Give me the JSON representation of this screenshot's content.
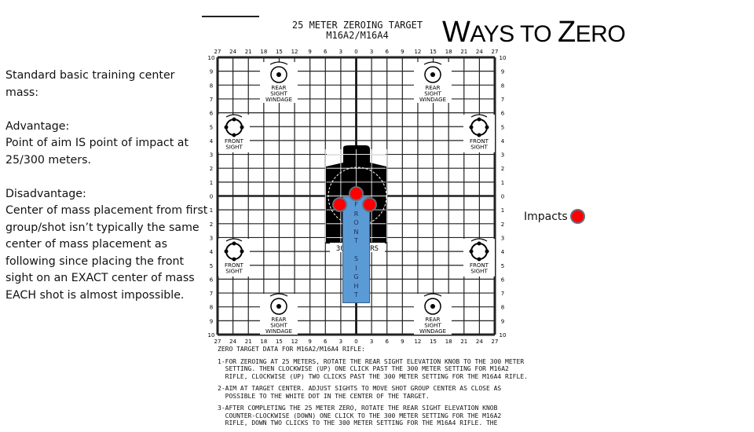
{
  "slide": {
    "title_first": "W",
    "title_rest": "AYS TO ",
    "title_z": "Z",
    "title_end": "ERO"
  },
  "left_text": {
    "heading": "Standard basic training center mass:",
    "advantage_label": "Advantage:",
    "advantage_text": "Point of aim IS point of impact at 25/300 meters.",
    "disadvantage_label": "Disadvantage:",
    "disadvantage_text": "Center of mass placement from first group/shot isn’t typically the same center of mass placement as following since placing the front sight on an EXACT center of mass EACH shot is almost impossible."
  },
  "target": {
    "title_line1": "25 METER ZEROING TARGET",
    "title_line2": "M16A2/M16A4",
    "col_labels": [
      "27",
      "24",
      "21",
      "18",
      "15",
      "12",
      "9",
      "6",
      "3",
      "0",
      "3",
      "6",
      "9",
      "12",
      "15",
      "18",
      "21",
      "24",
      "27"
    ],
    "row_labels": [
      "10",
      "9",
      "8",
      "7",
      "6",
      "5",
      "4",
      "3",
      "2",
      "1",
      "0",
      "1",
      "2",
      "3",
      "4",
      "5",
      "6",
      "7",
      "8",
      "9",
      "10"
    ],
    "rear_sight_label": [
      "REAR",
      "SIGHT",
      "WINDAGE"
    ],
    "front_sight_label": [
      "FRONT",
      "SIGHT"
    ],
    "silhouette_label": "300 METERS",
    "instructions_heading": "ZERO TARGET DATA FOR M16A2/M16A4 RIFLE:",
    "instructions": [
      "1-FOR ZEROING AT 25 METERS, ROTATE THE REAR SIGHT ELEVATION KNOB TO THE 300 METER\n  SETTING. THEN CLOCKWISE (UP) ONE CLICK PAST THE 300 METER SETTING FOR M16A2\n  RIFLE, CLOCKWISE (UP) TWO CLICKS PAST THE 300 METER SETTING FOR THE M16A4 RIFLE.",
      "2-AIM AT TARGET CENTER. ADJUST SIGHTS TO MOVE SHOT GROUP CENTER AS CLOSE AS\n  POSSIBLE TO THE WHITE DOT IN THE CENTER OF THE TARGET.",
      "3-AFTER COMPLETING THE 25 METER ZERO, ROTATE THE REAR SIGHT ELEVATION KNOB\n  COUNTER-CLOCKWISE (DOWN) ONE CLICK TO THE 300 METER SETTING FOR THE M16A2\n  RIFLE, DOWN TWO CLICKS TO THE 300 METER SETTING FOR THE M16A4 RIFLE. THE"
    ]
  },
  "front_sight_post": {
    "letters": [
      "F",
      "R",
      "O",
      "N",
      "T",
      "",
      "S",
      "I",
      "G",
      "H",
      "T"
    ],
    "color": "#5b9bd5"
  },
  "legend": {
    "label": "Impacts",
    "color": "#ff0000"
  }
}
